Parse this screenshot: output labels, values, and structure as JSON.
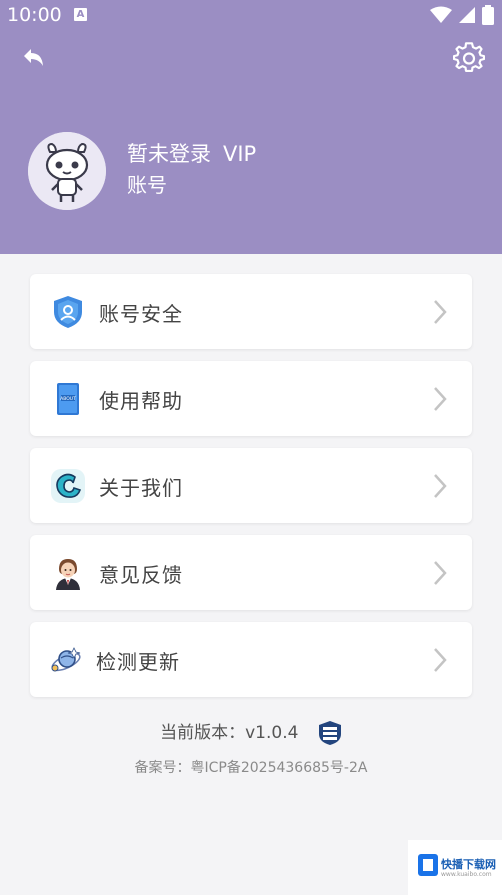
{
  "status_bar": {
    "time": "10:00",
    "notification_badge": "A",
    "icons": [
      "wifi-icon",
      "signal-icon",
      "battery-icon"
    ]
  },
  "header": {
    "back_icon": "back-arrow-icon",
    "settings_icon": "gear-icon",
    "username": "暂未登录",
    "vip": "VIP",
    "account_label": "账号",
    "colors": {
      "background": "#9b8ec3",
      "text": "#ffffff"
    }
  },
  "menu": {
    "items": [
      {
        "label": "账号安全",
        "icon": "shield-user-icon"
      },
      {
        "label": "使用帮助",
        "icon": "help-book-icon"
      },
      {
        "label": "关于我们",
        "icon": "about-logo-icon"
      },
      {
        "label": "意见反馈",
        "icon": "feedback-person-icon"
      },
      {
        "label": "检测更新",
        "icon": "update-satellite-icon"
      }
    ]
  },
  "footer": {
    "version_text": "当前版本：v1.0.4",
    "icp_text": "备案号：粤ICP备2025436685号-2A"
  },
  "watermark": {
    "brand": "快播下载网",
    "sub": "www.kuaibo.com"
  }
}
